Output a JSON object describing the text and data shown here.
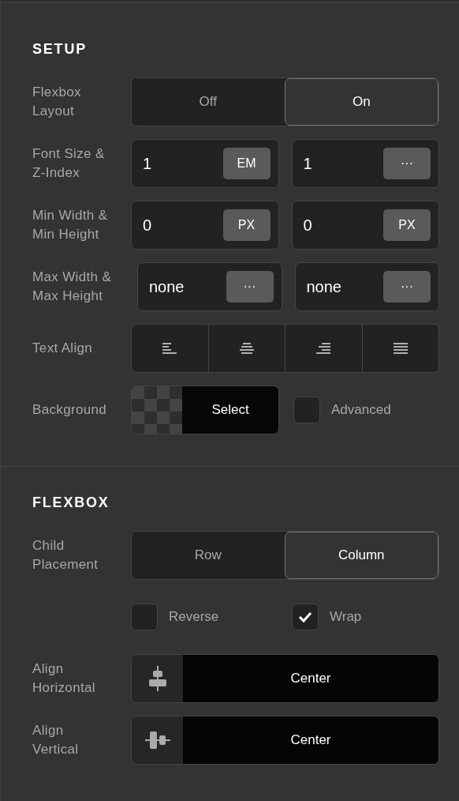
{
  "sections": [
    {
      "title": "SETUP",
      "rows": [
        {
          "kind": "segmented",
          "label": "Flexbox Layout",
          "options": [
            {
              "label": "Off",
              "selected": false
            },
            {
              "label": "On",
              "selected": true
            }
          ]
        },
        {
          "kind": "pair",
          "label": "Font Size & Z-Index",
          "fields": [
            {
              "value": "1",
              "unit": "EM"
            },
            {
              "value": "1",
              "unit": "···"
            }
          ]
        },
        {
          "kind": "pair",
          "label": "Min Width & Min Height",
          "fields": [
            {
              "value": "0",
              "unit": "PX"
            },
            {
              "value": "0",
              "unit": "PX"
            }
          ]
        },
        {
          "kind": "pair-wide",
          "label": "Max Width & Max Height",
          "fields": [
            {
              "value": "none",
              "unit": "···"
            },
            {
              "value": "none",
              "unit": "···"
            }
          ]
        },
        {
          "kind": "text-align",
          "label": "Text Align"
        },
        {
          "kind": "background",
          "label": "Background",
          "button": "Select",
          "checkbox": {
            "label": "Advanced",
            "checked": false
          }
        }
      ]
    },
    {
      "title": "FLEXBOX",
      "rows": [
        {
          "kind": "segmented",
          "label": "Child Placement",
          "options": [
            {
              "label": "Row",
              "selected": false
            },
            {
              "label": "Column",
              "selected": true
            }
          ]
        },
        {
          "kind": "checks",
          "items": [
            {
              "label": "Reverse",
              "checked": false
            },
            {
              "label": "Wrap",
              "checked": true
            }
          ]
        },
        {
          "kind": "align-h",
          "label": "Align Horizontal",
          "value": "Center"
        },
        {
          "kind": "align-v",
          "label": "Align Vertical",
          "value": "Center"
        }
      ]
    }
  ]
}
